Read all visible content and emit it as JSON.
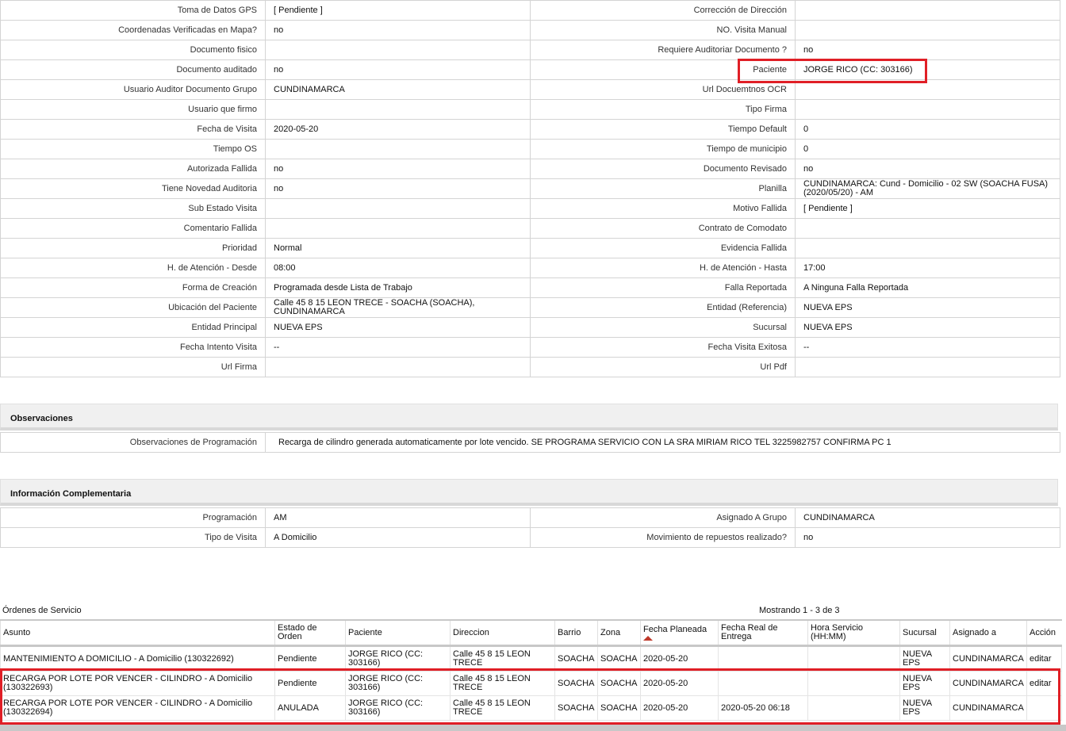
{
  "details": {
    "rows": [
      {
        "l1": "Toma de Datos GPS",
        "v1": "[ Pendiente ]",
        "l2": "Corrección de Dirección",
        "v2": ""
      },
      {
        "l1": "Coordenadas Verificadas en Mapa?",
        "v1": "no",
        "l2": "NO. Visita Manual",
        "v2": ""
      },
      {
        "l1": "Documento fisico",
        "v1": "",
        "l2": "Requiere Auditoriar Documento ?",
        "v2": "no"
      },
      {
        "l1": "Documento auditado",
        "v1": "no",
        "l2": "Paciente",
        "v2": "JORGE RICO (CC: 303166)"
      },
      {
        "l1": "Usuario Auditor Documento Grupo",
        "v1": "CUNDINAMARCA",
        "l2": "Url Docuemtnos OCR",
        "v2": ""
      },
      {
        "l1": "Usuario que firmo",
        "v1": "",
        "l2": "Tipo Firma",
        "v2": ""
      },
      {
        "l1": "Fecha de Visita",
        "v1": "2020-05-20",
        "l2": "Tiempo Default",
        "v2": "0"
      },
      {
        "l1": "Tiempo OS",
        "v1": "",
        "l2": "Tiempo de municipio",
        "v2": "0"
      },
      {
        "l1": "Autorizada Fallida",
        "v1": "no",
        "l2": "Documento Revisado",
        "v2": "no"
      },
      {
        "l1": "Tiene Novedad Auditoria",
        "v1": "no",
        "l2": "Planilla",
        "v2": "CUNDINAMARCA: Cund - Domicilio - 02 SW (SOACHA FUSA) (2020/05/20) - AM"
      },
      {
        "l1": "Sub Estado Visita",
        "v1": "",
        "l2": "Motivo Fallida",
        "v2": "[ Pendiente ]"
      },
      {
        "l1": "Comentario Fallida",
        "v1": "",
        "l2": "Contrato de Comodato",
        "v2": ""
      },
      {
        "l1": "Prioridad",
        "v1": "Normal",
        "l2": "Evidencia Fallida",
        "v2": ""
      },
      {
        "l1": "H. de Atención - Desde",
        "v1": "08:00",
        "l2": "H. de Atención - Hasta",
        "v2": "17:00"
      },
      {
        "l1": "Forma de Creación",
        "v1": "Programada desde Lista de Trabajo",
        "l2": "Falla Reportada",
        "v2": "A Ninguna Falla Reportada"
      },
      {
        "l1": "Ubicación del Paciente",
        "v1": "Calle 45 8 15 LEON TRECE - SOACHA (SOACHA), CUNDINAMARCA",
        "l2": "Entidad (Referencia)",
        "v2": "NUEVA EPS"
      },
      {
        "l1": "Entidad Principal",
        "v1": "NUEVA EPS",
        "l2": "Sucursal",
        "v2": "NUEVA EPS"
      },
      {
        "l1": "Fecha Intento Visita",
        "v1": "--",
        "l2": "Fecha Visita Exitosa",
        "v2": "--"
      },
      {
        "l1": "Url Firma",
        "v1": "",
        "l2": "Url Pdf",
        "v2": ""
      }
    ]
  },
  "observaciones": {
    "title": "Observaciones",
    "label": "Observaciones de Programación",
    "value": "Recarga de cilindro generada automaticamente por lote vencido. SE PROGRAMA SERVICIO CON LA SRA MIRIAM RICO TEL 3225982757 CONFIRMA PC 1"
  },
  "complementaria": {
    "title": "Información Complementaria",
    "rows": [
      {
        "l1": "Programación",
        "v1": "AM",
        "l2": "Asignado A Grupo",
        "v2": "CUNDINAMARCA"
      },
      {
        "l1": "Tipo de Visita",
        "v1": "A Domicilio",
        "l2": "Movimiento de repuestos realizado?",
        "v2": "no"
      }
    ]
  },
  "ordenes": {
    "title": "Órdenes de Servicio",
    "count": "Mostrando 1 - 3 de 3",
    "headers": [
      "Asunto",
      "Estado de Orden",
      "Paciente",
      "Direccion",
      "Barrio",
      "Zona",
      "Fecha Planeada",
      "Fecha Real de Entrega",
      "Hora Servicio (HH:MM)",
      "Sucursal",
      "Asignado a",
      "Acción"
    ],
    "rows": [
      {
        "asunto": "MANTENIMIENTO A DOMICILIO - A Domicilio (130322692)",
        "estado": "Pendiente",
        "paciente": "JORGE RICO (CC: 303166)",
        "direccion": "Calle 45 8 15 LEON TRECE",
        "barrio": "SOACHA",
        "zona": "SOACHA",
        "fecha": "2020-05-20",
        "real": "",
        "hora": "",
        "sucursal": "NUEVA EPS",
        "asignado": "CUNDINAMARCA",
        "accion": "editar"
      },
      {
        "asunto": "RECARGA POR LOTE POR VENCER - CILINDRO - A Domicilio (130322693)",
        "estado": "Pendiente",
        "paciente": "JORGE RICO (CC: 303166)",
        "direccion": "Calle 45 8 15 LEON TRECE",
        "barrio": "SOACHA",
        "zona": "SOACHA",
        "fecha": "2020-05-20",
        "real": "",
        "hora": "",
        "sucursal": "NUEVA EPS",
        "asignado": "CUNDINAMARCA",
        "accion": "editar"
      },
      {
        "asunto": "RECARGA POR LOTE POR VENCER - CILINDRO - A Domicilio (130322694)",
        "estado": "ANULADA",
        "paciente": "JORGE RICO (CC: 303166)",
        "direccion": "Calle 45 8 15 LEON TRECE",
        "barrio": "SOACHA",
        "zona": "SOACHA",
        "fecha": "2020-05-20",
        "real": "2020-05-20 06:18",
        "hora": "",
        "sucursal": "NUEVA EPS",
        "asignado": "CUNDINAMARCA",
        "accion": ""
      }
    ]
  },
  "colors": {
    "highlight": "#e01f26",
    "sort_arrow": "#c0392b"
  }
}
